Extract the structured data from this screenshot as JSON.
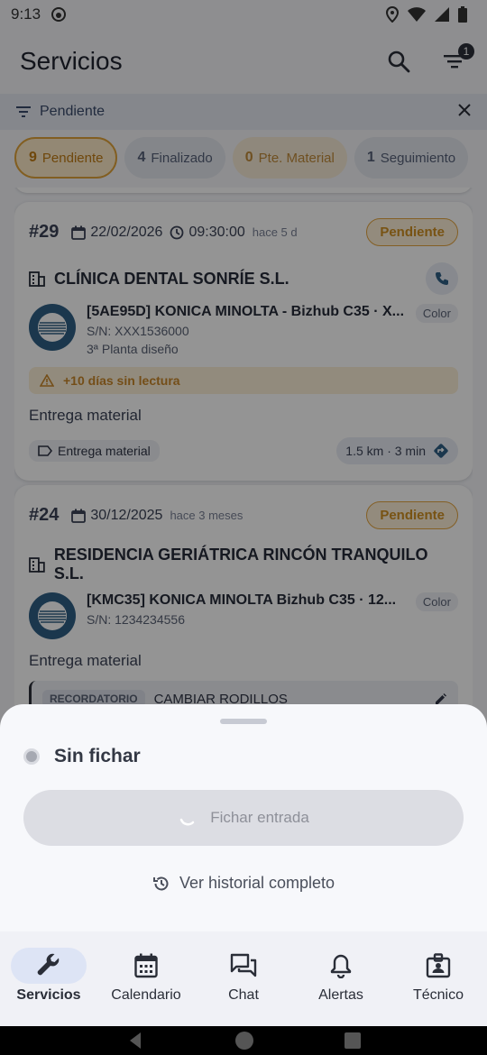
{
  "status_bar": {
    "time": "9:13"
  },
  "app_bar": {
    "title": "Servicios",
    "filter_count": "1"
  },
  "filter_bar": {
    "label": "Pendiente"
  },
  "chips": [
    {
      "count": "9",
      "label": "Pendiente"
    },
    {
      "count": "4",
      "label": "Finalizado"
    },
    {
      "count": "0",
      "label": "Pte. Material"
    },
    {
      "count": "1",
      "label": "Seguimiento"
    }
  ],
  "cards": [
    {
      "number": "#29",
      "date": "22/02/2026",
      "time": "09:30:00",
      "ago": "hace 5 d",
      "status": "Pendiente",
      "client": "CLÍNICA DENTAL SONRÍE S.L.",
      "device_title": "[5AE95D] KONICA MINOLTA - Bizhub C35 · X...",
      "device_color": "Color",
      "serial": "S/N: XXX1536000",
      "location": "3ª Planta diseño",
      "warning": "+10 días sin lectura",
      "description": "Entrega material",
      "tag": "Entrega material",
      "distance": "1.5 km · 3 min"
    },
    {
      "number": "#24",
      "date": "30/12/2025",
      "ago": "hace 3 meses",
      "status": "Pendiente",
      "client": "RESIDENCIA GERIÁTRICA RINCÓN TRANQUILO S.L.",
      "device_title": "[KMC35] KONICA MINOLTA Bizhub C35 · 12...",
      "device_color": "Color",
      "serial": "S/N: 1234234556",
      "description": "Entrega material",
      "reminder_label": "RECORDATORIO",
      "reminder_text": "CAMBIAR RODILLOS"
    }
  ],
  "sheet": {
    "status": "Sin fichar",
    "punch_label": "Fichar entrada",
    "history_label": "Ver historial completo"
  },
  "bottom_nav": [
    {
      "label": "Servicios",
      "icon": "wrench-icon"
    },
    {
      "label": "Calendario",
      "icon": "calendar-icon"
    },
    {
      "label": "Chat",
      "icon": "chat-icon"
    },
    {
      "label": "Alertas",
      "icon": "bell-icon"
    },
    {
      "label": "Técnico",
      "icon": "badge-icon"
    }
  ],
  "colors": {
    "pending_accent": "#e3a43f",
    "logo_blue": "#2f5f86",
    "nav_active": "#dde4f5"
  }
}
